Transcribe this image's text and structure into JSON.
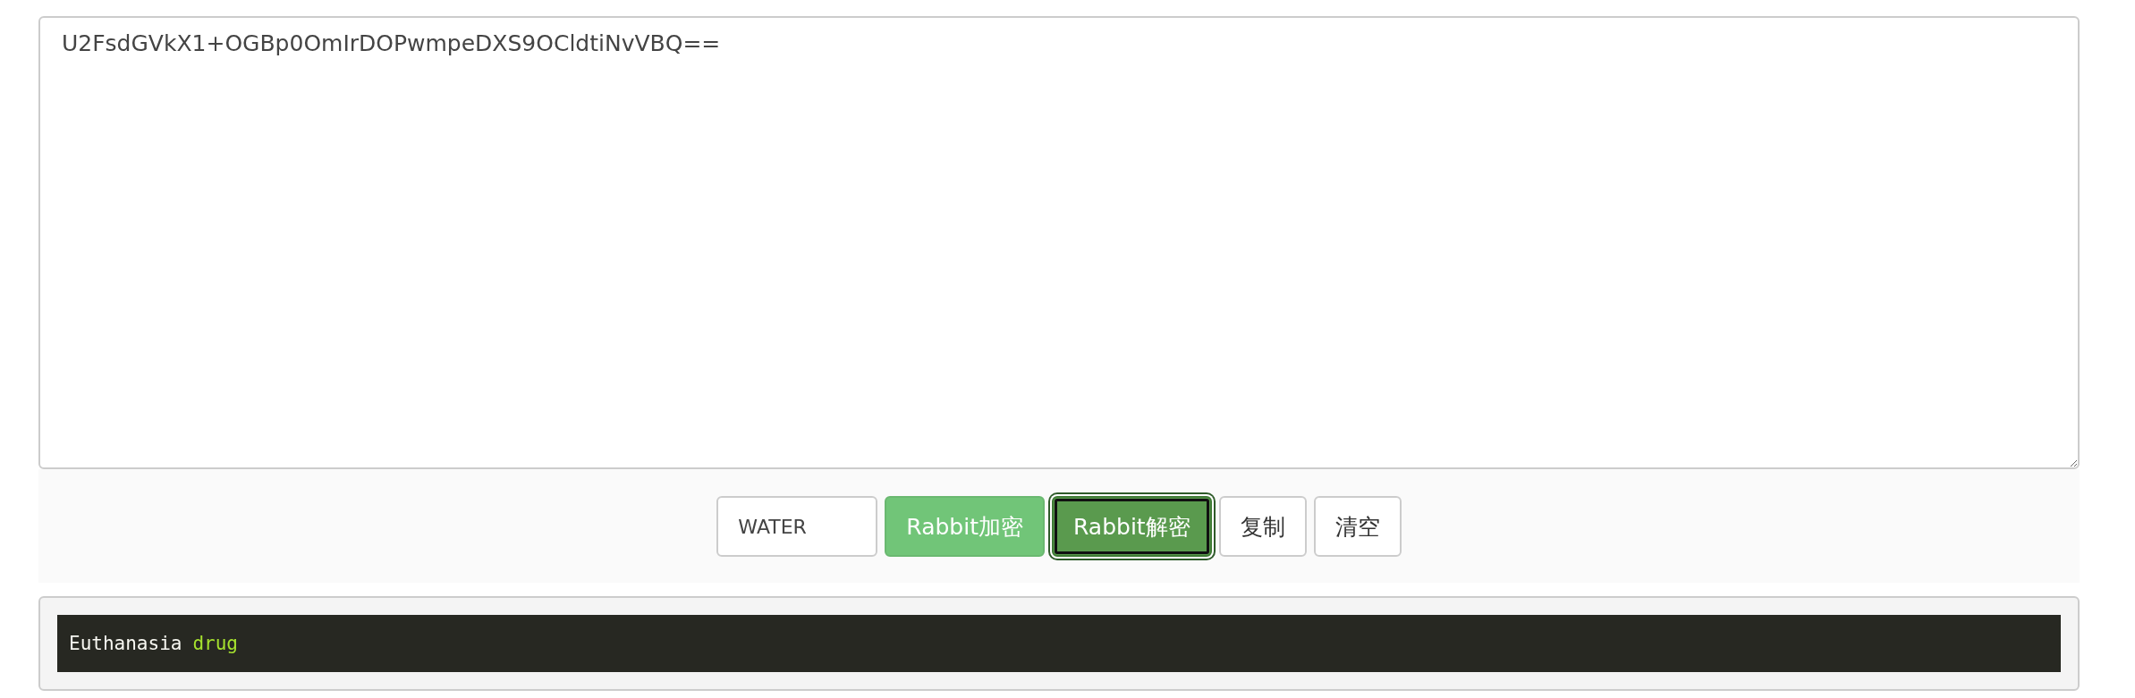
{
  "editor": {
    "value": "U2FsdGVkX1+OGBp0OmIrDOPwmpeDXS9OCldtiNvVBQ=="
  },
  "controls": {
    "key_field": {
      "value": "WATER"
    },
    "buttons": [
      {
        "label": "Rabbit加密",
        "kind": "light",
        "focused": false
      },
      {
        "label": "Rabbit解密",
        "kind": "dark",
        "focused": true
      },
      {
        "label": "复制",
        "kind": "plain",
        "focused": false
      },
      {
        "label": "清空",
        "kind": "plain",
        "focused": false
      }
    ]
  },
  "output": {
    "tokens": [
      {
        "text": "Euthanasia",
        "color": "#f8f8f2"
      },
      {
        "text": "drug",
        "color": "#a6e22e"
      }
    ]
  }
}
